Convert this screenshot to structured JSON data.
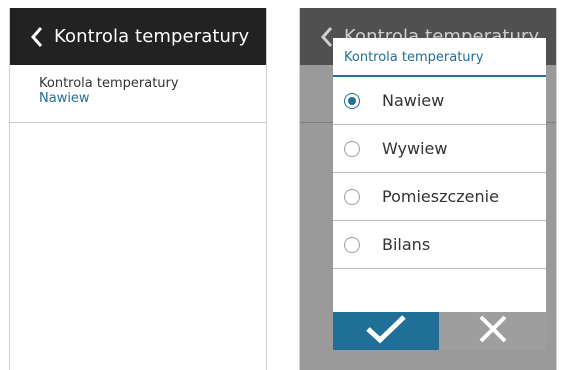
{
  "left_screen": {
    "header": {
      "title": "Kontrola temperatury"
    },
    "setting": {
      "label": "Kontrola temperatury",
      "value": "Nawiew"
    }
  },
  "right_screen": {
    "header": {
      "title": "Kontrola temperatury"
    },
    "dialog": {
      "title": "Kontrola temperatury",
      "selected": "Nawiew",
      "options": [
        {
          "label": "Nawiew",
          "checked": true
        },
        {
          "label": "Wywiew",
          "checked": false
        },
        {
          "label": "Pomieszczenie",
          "checked": false
        },
        {
          "label": "Bilans",
          "checked": false
        }
      ],
      "buttons": {
        "ok_icon": "checkmark-icon",
        "cancel_icon": "close-icon"
      }
    }
  },
  "colors": {
    "header_bg": "#222222",
    "accent": "#1f6f99",
    "overlay": "#9a9a9a",
    "cancel_button": "#9e9e9e"
  }
}
